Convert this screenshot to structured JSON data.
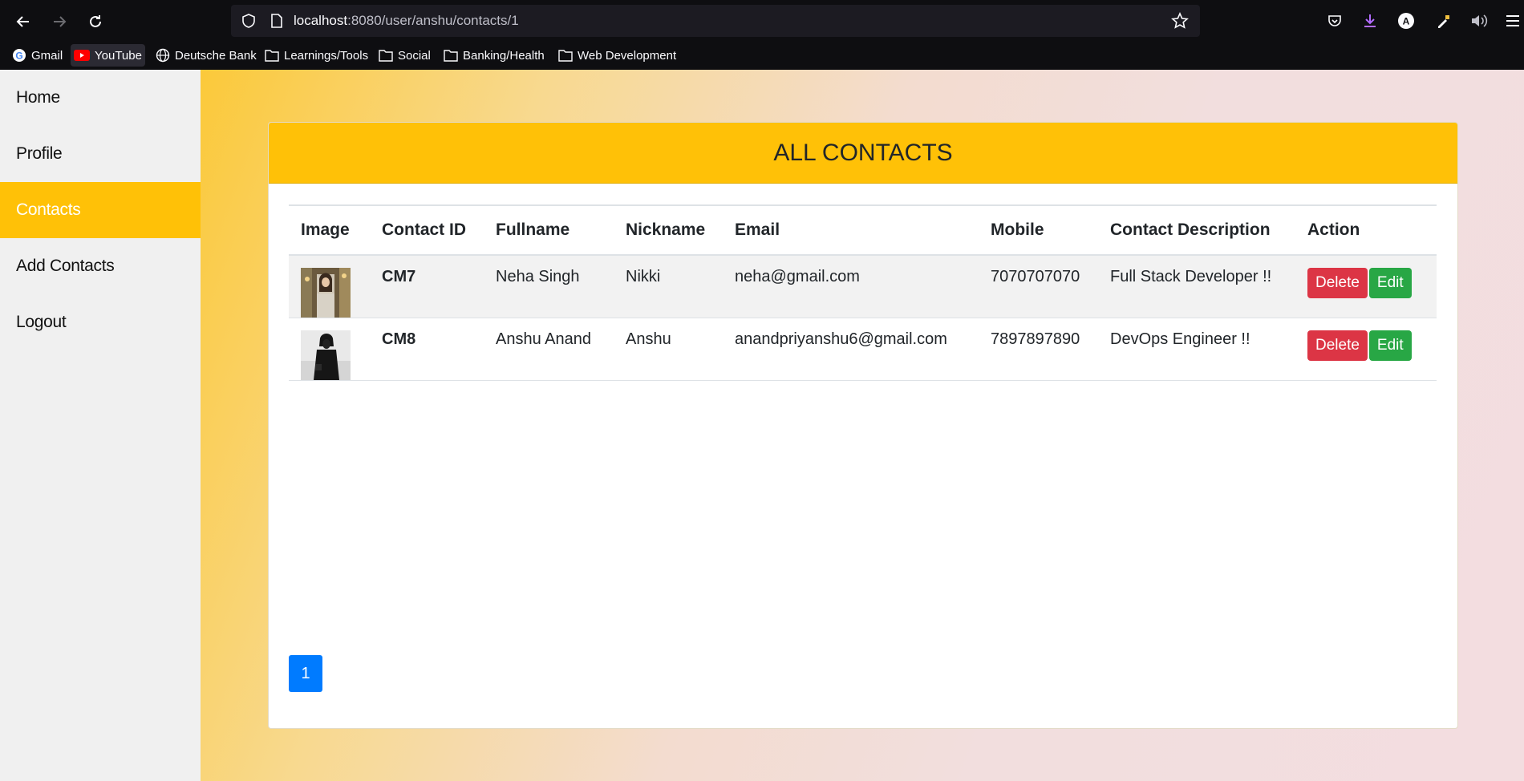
{
  "browser": {
    "url_host": "localhost",
    "url_path": ":8080/user/anshu/contacts/1",
    "bookmarks": [
      {
        "label": "Gmail",
        "icon": "google-icon"
      },
      {
        "label": "YouTube",
        "icon": "youtube-icon"
      },
      {
        "label": "Deutsche Bank",
        "icon": "globe-icon"
      },
      {
        "label": "Learnings/Tools",
        "icon": "folder-icon"
      },
      {
        "label": "Social",
        "icon": "folder-icon"
      },
      {
        "label": "Banking/Health",
        "icon": "folder-icon"
      },
      {
        "label": "Web Development",
        "icon": "folder-icon"
      }
    ]
  },
  "sidebar": {
    "items": [
      {
        "label": "Home"
      },
      {
        "label": "Profile"
      },
      {
        "label": "Contacts",
        "active": true
      },
      {
        "label": "Add Contacts"
      },
      {
        "label": "Logout"
      }
    ]
  },
  "card": {
    "title": "ALL CONTACTS"
  },
  "table": {
    "headers": [
      "Image",
      "Contact ID",
      "Fullname",
      "Nickname",
      "Email",
      "Mobile",
      "Contact Description",
      "Action"
    ],
    "rows": [
      {
        "id": "CM7",
        "fullname": "Neha Singh",
        "nickname": "Nikki",
        "email": "neha@gmail.com",
        "mobile": "7070707070",
        "description": "Full Stack Developer !!"
      },
      {
        "id": "CM8",
        "fullname": "Anshu Anand",
        "nickname": "Anshu",
        "email": "anandpriyanshu6@gmail.com",
        "mobile": "7897897890",
        "description": "DevOps Engineer !!"
      }
    ],
    "delete_label": "Delete",
    "edit_label": "Edit"
  },
  "pagination": {
    "current_page": "1"
  },
  "colors": {
    "accent": "#ffc107",
    "delete": "#dc3545",
    "edit": "#28a745",
    "page": "#007bff"
  }
}
